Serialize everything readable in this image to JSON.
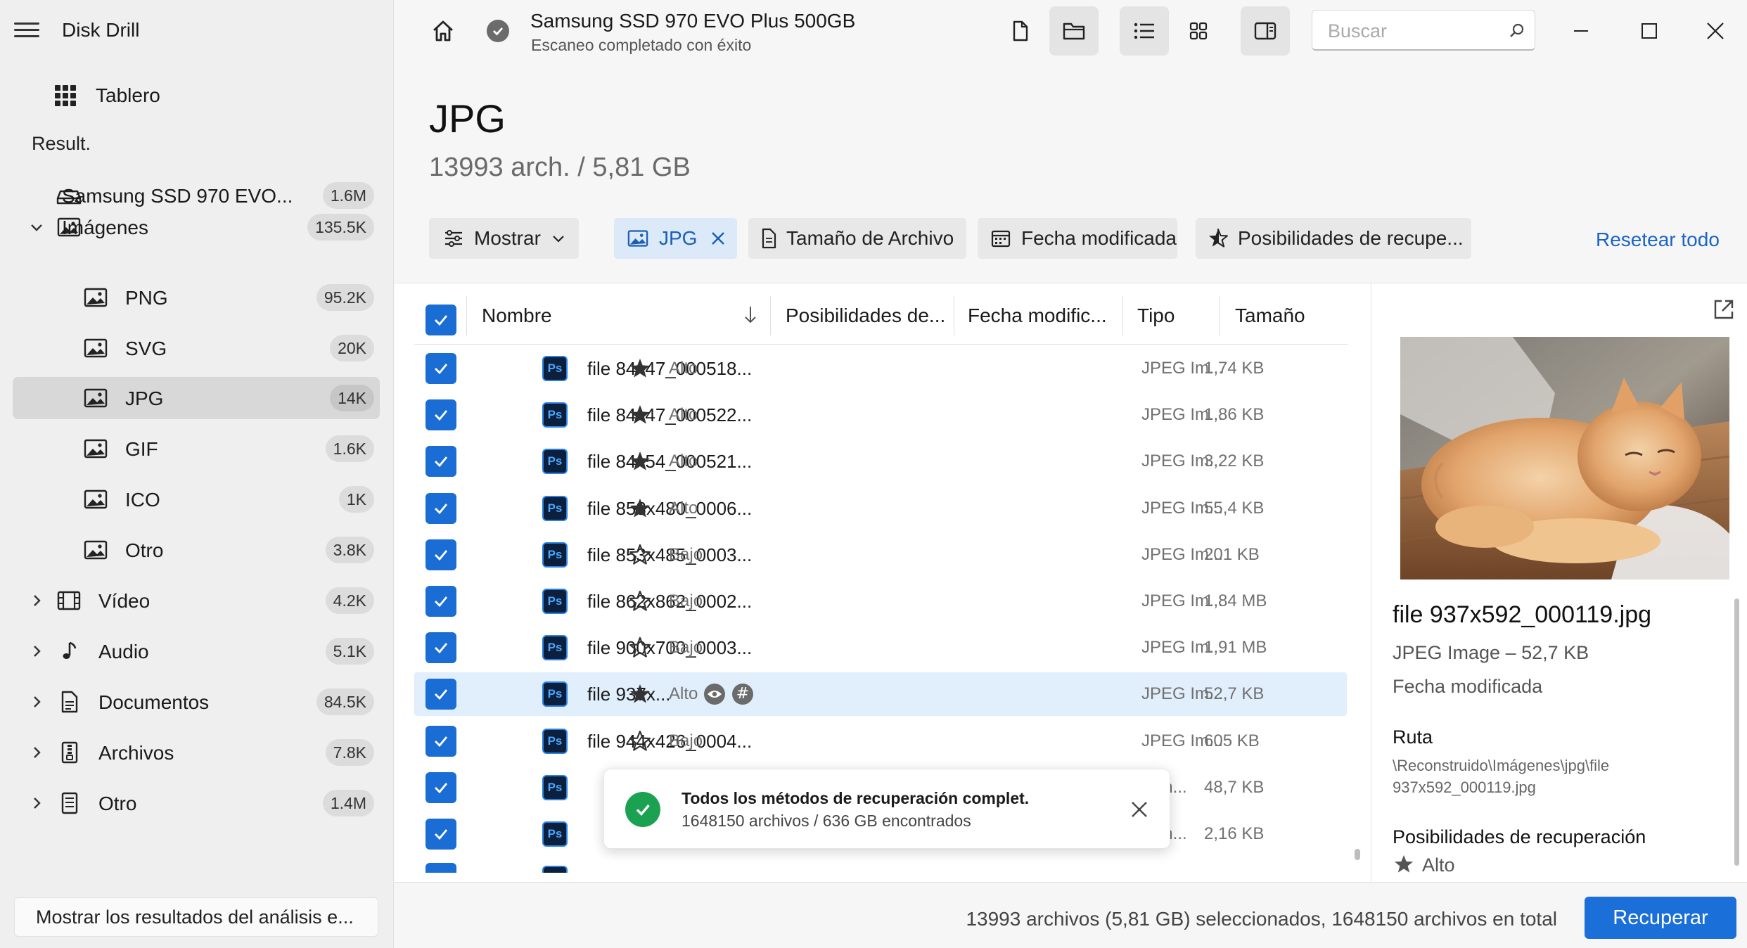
{
  "app": {
    "title": "Disk Drill"
  },
  "sidebar": {
    "dashboard": "Tablero",
    "results_label": "Result.",
    "items": [
      {
        "label": "Samsung SSD 970 EVO...",
        "count": "1.6M",
        "icon": "drive-icon"
      },
      {
        "label": "Imágenes",
        "count": "135.5K",
        "icon": "image-icon",
        "expanded": true
      },
      {
        "label": "PNG",
        "count": "95.2K",
        "icon": "image-icon"
      },
      {
        "label": "SVG",
        "count": "20K",
        "icon": "image-icon"
      },
      {
        "label": "JPG",
        "count": "14K",
        "icon": "image-icon",
        "selected": true
      },
      {
        "label": "GIF",
        "count": "1.6K",
        "icon": "image-icon"
      },
      {
        "label": "ICO",
        "count": "1K",
        "icon": "image-icon"
      },
      {
        "label": "Otro",
        "count": "3.8K",
        "icon": "image-icon"
      },
      {
        "label": "Vídeo",
        "count": "4.2K",
        "icon": "film-icon"
      },
      {
        "label": "Audio",
        "count": "5.1K",
        "icon": "music-note-icon"
      },
      {
        "label": "Documentos",
        "count": "84.5K",
        "icon": "document-icon"
      },
      {
        "label": "Archivos",
        "count": "7.8K",
        "icon": "archive-icon"
      },
      {
        "label": "Otro",
        "count": "1.4M",
        "icon": "other-file-icon"
      }
    ],
    "bottom_button": "Mostrar los resultados del análisis e..."
  },
  "topbar": {
    "device_title": "Samsung SSD 970 EVO Plus 500GB",
    "device_status": "Escaneo completado con éxito",
    "search_placeholder": "Buscar"
  },
  "header": {
    "title": "JPG",
    "subtitle": "13993 arch. / 5,81 GB"
  },
  "filters": {
    "show": "Mostrar",
    "jpg": "JPG",
    "size": "Tamaño de Archivo",
    "date": "Fecha modificada",
    "chances": "Posibilidades de recupe...",
    "reset": "Resetear todo"
  },
  "table": {
    "columns": {
      "name": "Nombre",
      "chances": "Posibilidades de...",
      "date": "Fecha modific...",
      "type": "Tipo",
      "size": "Tamaño"
    },
    "rows": [
      {
        "name": "file 84x47_000518...",
        "chance": "Alto",
        "type": "JPEG Im...",
        "size": "1,74 KB"
      },
      {
        "name": "file 84x47_000522...",
        "chance": "Alto",
        "type": "JPEG Im...",
        "size": "1,86 KB"
      },
      {
        "name": "file 84x54_000521...",
        "chance": "Alto",
        "type": "JPEG Im...",
        "size": "3,22 KB"
      },
      {
        "name": "file 853x480_0006...",
        "chance": "Alto",
        "type": "JPEG Im...",
        "size": "55,4 KB"
      },
      {
        "name": "file 853x485_0003...",
        "chance": "Bajo",
        "type": "JPEG Im...",
        "size": "201 KB"
      },
      {
        "name": "file 862x862_0002...",
        "chance": "Bajo",
        "type": "JPEG Im...",
        "size": "1,84 MB"
      },
      {
        "name": "file 900x700_0003...",
        "chance": "Bajo",
        "type": "JPEG Im...",
        "size": "1,91 MB"
      },
      {
        "name": "file 937x...",
        "chance": "Alto",
        "type": "JPEG Im...",
        "size": "52,7 KB"
      },
      {
        "name": "file 944x426_0004...",
        "chance": "Bajo",
        "type": "JPEG Im...",
        "size": "605 KB"
      },
      {
        "name": "",
        "chance": "",
        "type": "Im...",
        "size": "48,7 KB"
      },
      {
        "name": "",
        "chance": "",
        "type": "Im...",
        "size": "2,16 KB"
      }
    ]
  },
  "toast": {
    "title": "Todos los métodos de recuperación complet.",
    "subtitle": "1648150 archivos / 636 GB encontrados"
  },
  "preview": {
    "file_name": "file 937x592_000119.jpg",
    "file_info": "JPEG Image – 52,7 KB",
    "date_label": "Fecha modificada",
    "path_label": "Ruta",
    "path_value": "\\Reconstruido\\Imágenes\\jpg\\file 937x592_000119.jpg",
    "chances_label": "Posibilidades de recuperación",
    "chances_value": "Alto"
  },
  "footer": {
    "status": "13993 archivos (5,81 GB) seleccionados, 1648150 archivos en total",
    "recover": "Recuperar"
  },
  "colors": {
    "accent": "#1a6fd8",
    "success": "#1aa251",
    "selected_row": "#e1eefb"
  }
}
